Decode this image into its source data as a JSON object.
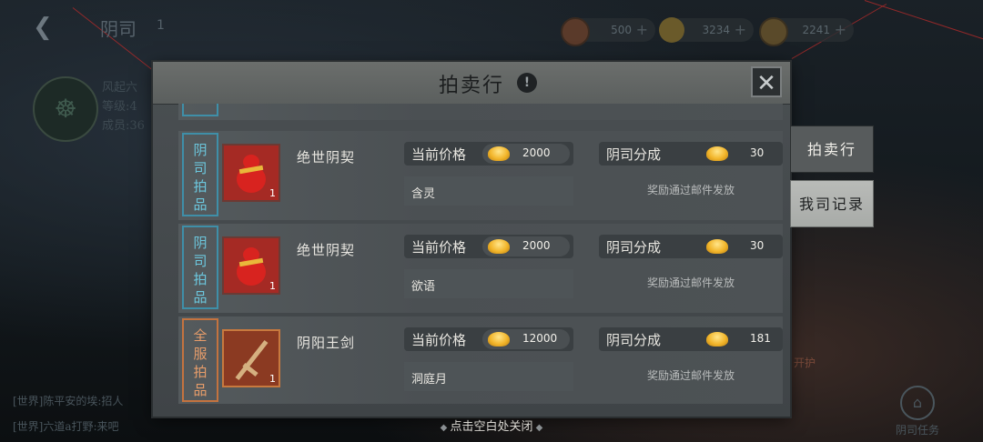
{
  "background": {
    "back_icon": "back-arrow-icon",
    "guild_title": "阴司",
    "guild_count": "1",
    "guild_info_name": "风起六",
    "guild_info_level": "等级:4",
    "guild_info_members": "成员:36",
    "chat_lines": [
      "[世界]陈平安的埃:招人",
      "[世界]六道a打野:来吧"
    ],
    "task_label": "阴司任务",
    "side_partial_text": "开护"
  },
  "resources": [
    {
      "icon": "token-icon",
      "value": "500"
    },
    {
      "icon": "gold-ingot-icon",
      "value": "3234"
    },
    {
      "icon": "coin-icon",
      "value": "2241"
    }
  ],
  "modal": {
    "title": "拍卖行",
    "info_icon": "!",
    "close_icon": "close-x-icon"
  },
  "side_tabs": [
    {
      "label": "拍卖行",
      "active": true
    },
    {
      "label": "我司记录",
      "active": false
    }
  ],
  "rows": [
    {
      "tag": [
        "阴",
        "司",
        "拍",
        "品"
      ],
      "tag_color": "#3f8fa8",
      "item_icon": "red-gourd-icon",
      "item_qty": "1",
      "item_name": "绝世阴契",
      "price_label": "当前价格",
      "price": "2000",
      "buyer": "含灵",
      "share_label": "阴司分成",
      "share": "30",
      "note": "奖励通过邮件发放"
    },
    {
      "tag": [
        "阴",
        "司",
        "拍",
        "品"
      ],
      "tag_color": "#3f8fa8",
      "item_icon": "red-gourd-icon",
      "item_qty": "1",
      "item_name": "绝世阴契",
      "price_label": "当前价格",
      "price": "2000",
      "buyer": "欲语",
      "share_label": "阴司分成",
      "share": "30",
      "note": "奖励通过邮件发放"
    },
    {
      "tag": [
        "全",
        "服",
        "拍",
        "品"
      ],
      "tag_color": "#c4733f",
      "item_icon": "sword-icon",
      "item_qty": "1",
      "item_name": "阴阳王剑",
      "price_label": "当前价格",
      "price": "12000",
      "buyer": "洞庭月",
      "share_label": "阴司分成",
      "share": "181",
      "note": "奖励通过邮件发放"
    }
  ],
  "footer_hint": "点击空白处关闭"
}
